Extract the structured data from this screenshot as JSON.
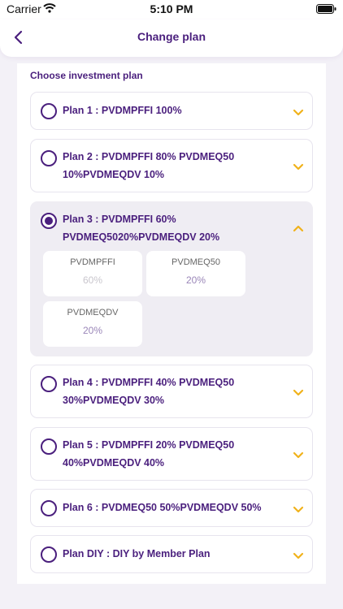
{
  "status_bar": {
    "carrier": "Carrier",
    "time": "5:10 PM"
  },
  "header": {
    "title": "Change plan"
  },
  "section_title": "Choose investment plan",
  "colors": {
    "primary": "#4a1f7d",
    "accent_chevron": "#f0b21b",
    "background": "#f3f1f7"
  },
  "plans": [
    {
      "line1": "Plan 1 : PVDMPFFI 100%",
      "line2": "",
      "selected": false,
      "expanded": false
    },
    {
      "line1": "Plan 2 : PVDMPFFI 80% PVDMEQ50",
      "line2": "10%PVDMEQDV 10%",
      "selected": false,
      "expanded": false
    },
    {
      "line1": "Plan 3 : PVDMPFFI 60%",
      "line2": "PVDMEQ5020%PVDMEQDV 20%",
      "selected": true,
      "expanded": true,
      "funds": [
        {
          "name": "PVDMPFFI",
          "value": "60%"
        },
        {
          "name": "PVDMEQ50",
          "value": "20%"
        },
        {
          "name": "PVDMEQDV",
          "value": "20%"
        }
      ]
    },
    {
      "line1": "Plan 4 : PVDMPFFI 40% PVDMEQ50",
      "line2": "30%PVDMEQDV 30%",
      "selected": false,
      "expanded": false
    },
    {
      "line1": "Plan 5 : PVDMPFFI 20% PVDMEQ50",
      "line2": "40%PVDMEQDV 40%",
      "selected": false,
      "expanded": false
    },
    {
      "line1": "Plan 6 : PVDMEQ50 50%PVDMEQDV 50%",
      "line2": "",
      "selected": false,
      "expanded": false
    },
    {
      "line1": "Plan DIY : DIY by Member Plan",
      "line2": "",
      "selected": false,
      "expanded": false
    }
  ]
}
